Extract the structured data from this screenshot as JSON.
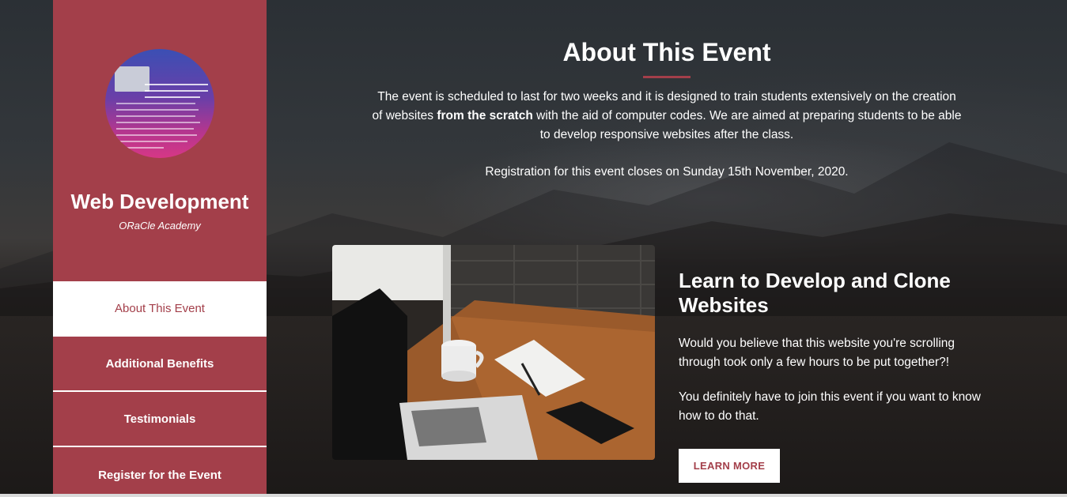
{
  "sidebar": {
    "title": "Web Development",
    "subtitle": "ORaCle Academy",
    "logo_icon": "event-flyer-logo",
    "accent_color": "#a33f4a",
    "nav": [
      {
        "label": "About This Event",
        "active": true
      },
      {
        "label": "Additional Benefits",
        "active": false
      },
      {
        "label": "Testimonials",
        "active": false
      },
      {
        "label": "Register for the Event",
        "active": false
      }
    ]
  },
  "main": {
    "title": "About This Event",
    "intro_before": "The event is scheduled to last for two weeks and it is designed to train students extensively on the creation of websites ",
    "intro_bold": "from the scratch",
    "intro_after": " with the aid of computer codes. We are aimed at preparing students to be able to develop responsive websites after the class.",
    "registration": "Registration for this event closes on Sunday 15th November, 2020."
  },
  "feature": {
    "title": "Learn to Develop and Clone Websites",
    "paragraph1": "Would you believe that this website you're scrolling through took only a few hours to be put together?!",
    "paragraph2": "You definitely have to join this event if you want to know how to do that.",
    "button": "LEARN MORE",
    "image_icon": "laptop-desk-photo"
  }
}
